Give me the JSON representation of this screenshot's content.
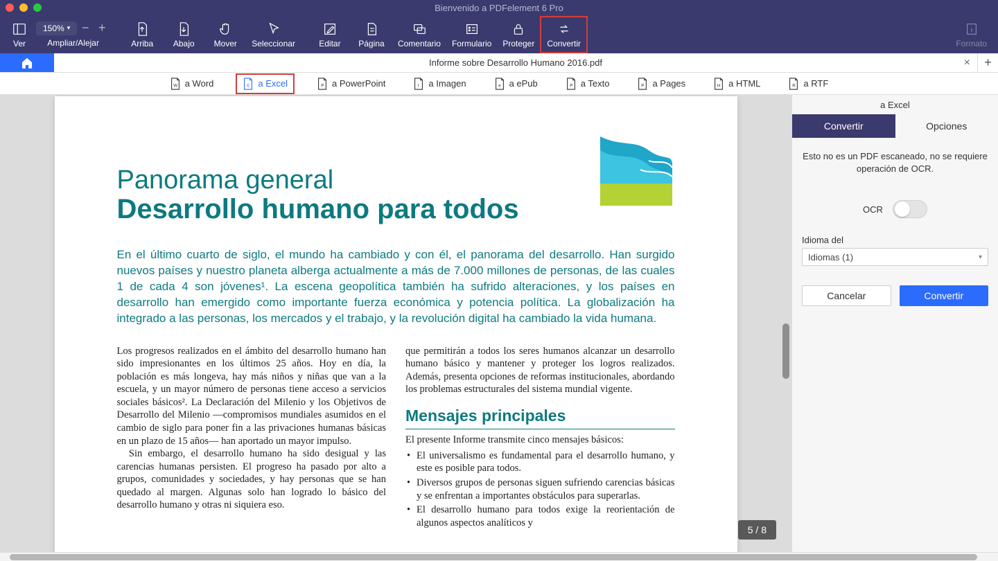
{
  "app_title": "Bienvenido a PDFelement 6 Pro",
  "toolbar": {
    "view": "Ver",
    "zoom_label": "Ampliar/Alejar",
    "zoom_value": "150%",
    "up": "Arriba",
    "down": "Abajo",
    "move": "Mover",
    "select": "Seleccionar",
    "edit": "Editar",
    "page": "Página",
    "comment": "Comentario",
    "form": "Formulario",
    "protect": "Proteger",
    "convert": "Convertir",
    "format": "Formato"
  },
  "tabs": {
    "doc_title": "Informe sobre Desarrollo Humano 2016.pdf"
  },
  "formats": {
    "word": "a Word",
    "excel": "a Excel",
    "powerpoint": "a PowerPoint",
    "image": "a Imagen",
    "epub": "a ePub",
    "text": "a Texto",
    "pages": "a Pages",
    "html": "a HTML",
    "rtf": "a RTF"
  },
  "sidebar": {
    "title": "a Excel",
    "tab_convert": "Convertir",
    "tab_options": "Opciones",
    "message": "Esto no es un PDF escaneado, no se requiere operación de OCR.",
    "ocr_label": "OCR",
    "lang_label": "Idioma del",
    "lang_value": "Idiomas (1)",
    "cancel": "Cancelar",
    "convert": "Convertir"
  },
  "page_counter": "5 / 8",
  "doc": {
    "h1": "Panorama general",
    "h2": "Desarrollo humano para todos",
    "intro": "En el último cuarto de siglo, el mundo ha cambiado y con él, el panorama del desarrollo. Han surgido nuevos países y nuestro planeta alberga actualmente a más de 7.000 millones de personas, de las cuales 1 de cada 4 son jóvenes¹. La escena geopolítica también ha sufrido alteraciones, y los países en desarrollo han emergido como importante fuerza económica y potencia política. La globalización ha integrado a las personas, los mercados y el trabajo, y la revolución digital ha cambiado la vida humana.",
    "col1_p1": "Los progresos realizados en el ámbito del desarrollo humano han sido impresionantes en los últimos 25 años. Hoy en día, la población es más longeva, hay más niños y niñas que van a la escuela, y un mayor número de personas tiene acceso a servicios sociales básicos². La Declaración del Milenio y los Objetivos de Desarrollo del Milenio —compromisos mundiales asumidos en el cambio de siglo para poner fin a las privaciones humanas básicas en un plazo de 15 años— han aportado un mayor impulso.",
    "col1_p2": "Sin embargo, el desarrollo humano ha sido desigual y las carencias humanas persisten. El progreso ha pasado por alto a grupos, comunidades y sociedades, y hay personas que se han quedado al margen. Algunas solo han logrado lo básico del desarrollo humano y otras ni siquiera eso.",
    "col2_p1": "que permitirán a todos los seres humanos alcanzar un desarrollo humano básico y mantener y proteger los logros realizados. Además, presenta opciones de reformas institucionales, abordando los problemas estructurales del sistema mundial vigente.",
    "col2_h3": "Mensajes principales",
    "col2_p2": "El presente Informe transmite cinco mensajes básicos:",
    "bullets": [
      "El universalismo es fundamental para el desarrollo humano, y este es posible para todos.",
      "Diversos grupos de personas siguen sufriendo carencias básicas y se enfrentan a importantes obstáculos para superarlas.",
      "El desarrollo humano para todos exige la reorientación de algunos aspectos analíticos y"
    ]
  },
  "colors": {
    "toolbar_bg": "#3a3a6e",
    "accent_blue": "#2b6cff",
    "highlight_red": "#d23c3c",
    "teal": "#0d7a80"
  }
}
